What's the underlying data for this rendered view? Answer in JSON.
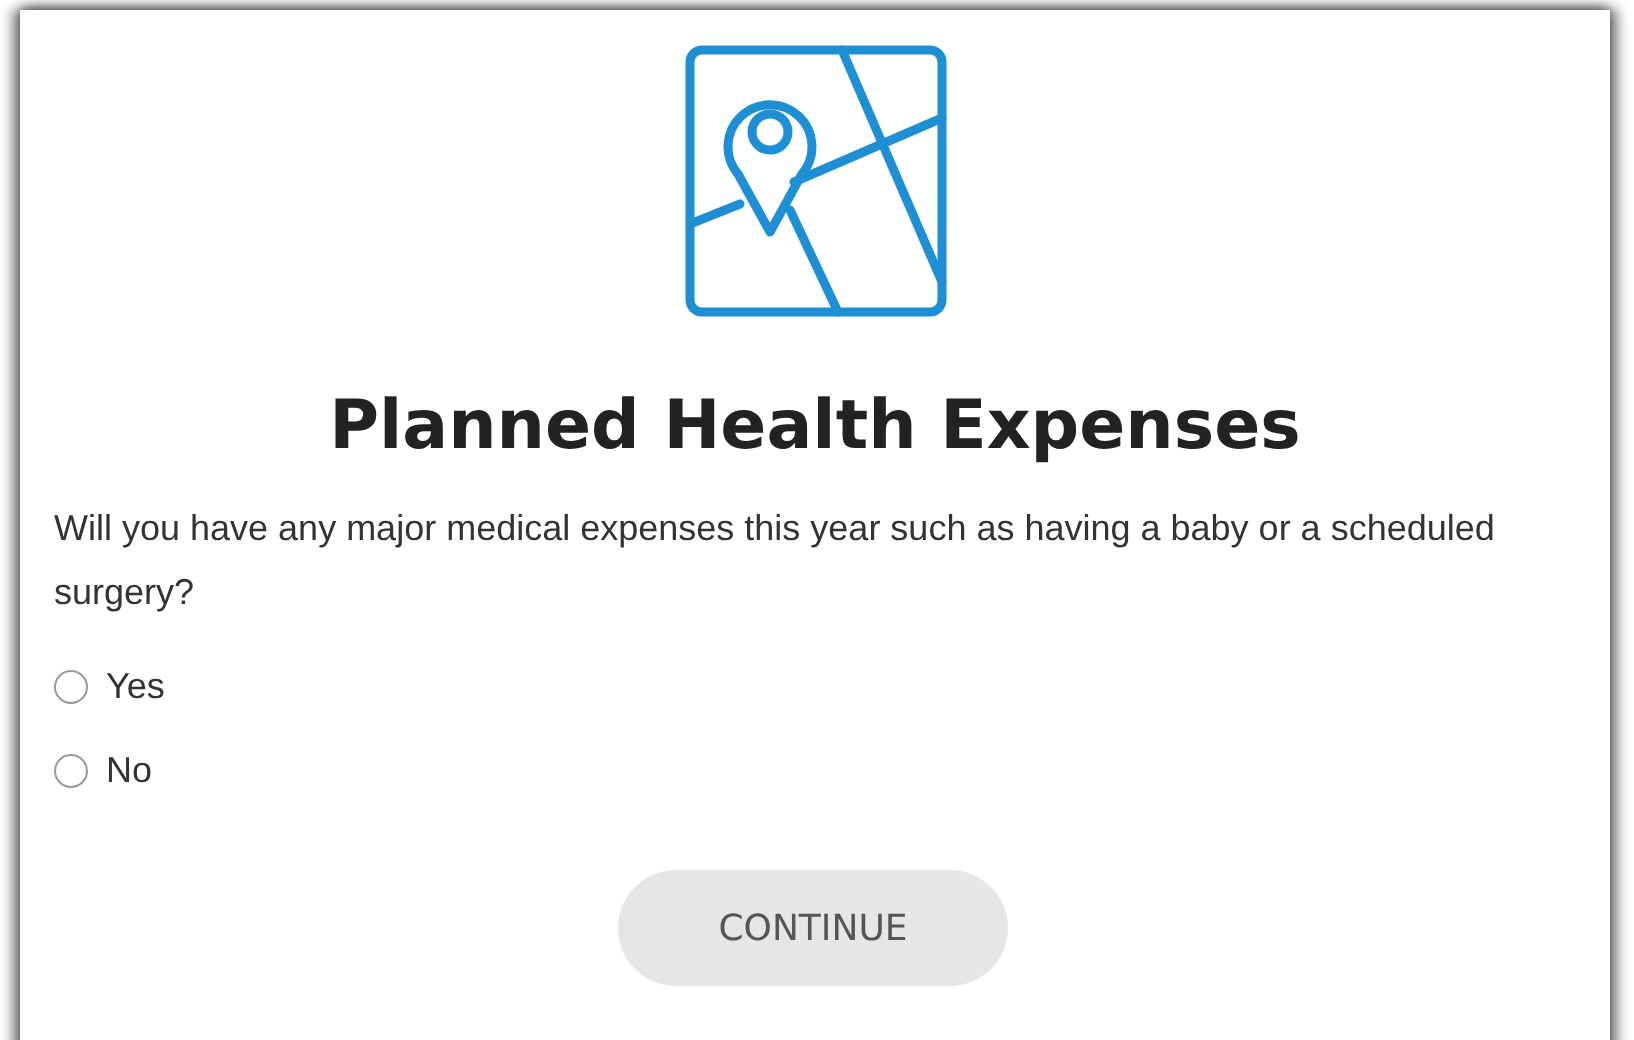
{
  "title": "Planned Health Expenses",
  "question": "Will you have any major medical expenses this year such as having a baby or a scheduled surgery?",
  "options": [
    {
      "label": "Yes",
      "selected": false
    },
    {
      "label": "No",
      "selected": false
    }
  ],
  "continue_button": {
    "label": "CONTINUE",
    "disabled": true
  }
}
